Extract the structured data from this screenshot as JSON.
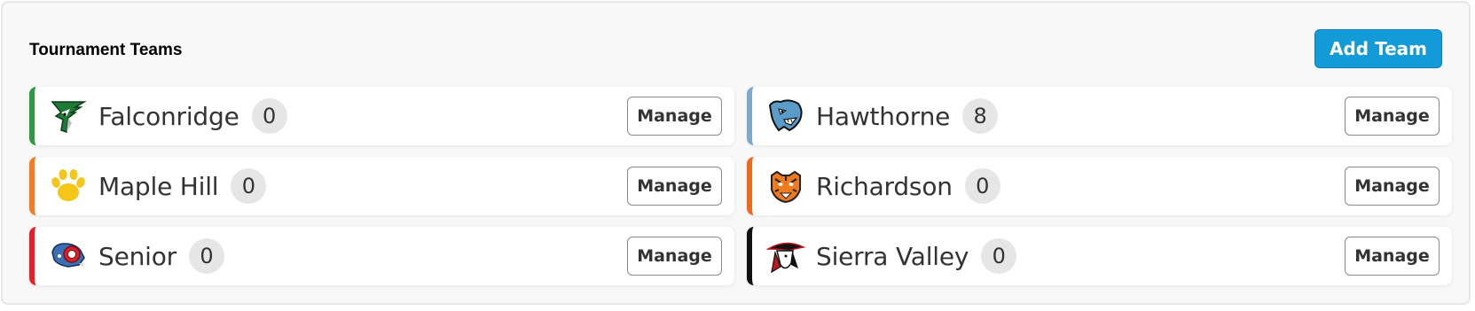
{
  "panel": {
    "title": "Tournament Teams",
    "add_button_label": "Add Team"
  },
  "teams": [
    {
      "name": "Falconridge",
      "count": "0",
      "accent": "#2e9a3e",
      "icon": "falcon-logo-icon",
      "manage_label": "Manage"
    },
    {
      "name": "Hawthorne",
      "count": "8",
      "accent": "#7aa9cc",
      "icon": "panther-logo-icon",
      "manage_label": "Manage"
    },
    {
      "name": "Maple Hill",
      "count": "0",
      "accent": "#f57c1f",
      "icon": "paw-logo-icon",
      "manage_label": "Manage"
    },
    {
      "name": "Richardson",
      "count": "0",
      "accent": "#f06a1e",
      "icon": "tiger-logo-icon",
      "manage_label": "Manage"
    },
    {
      "name": "Senior",
      "count": "0",
      "accent": "#ee1c25",
      "icon": "ram-logo-icon",
      "manage_label": "Manage"
    },
    {
      "name": "Sierra Valley",
      "count": "0",
      "accent": "#111111",
      "icon": "pirate-logo-icon",
      "manage_label": "Manage"
    }
  ],
  "colors": {
    "add_button": "#129bd6",
    "count_badge": "#e6e6e6",
    "panel_background": "#f8f8f8"
  }
}
